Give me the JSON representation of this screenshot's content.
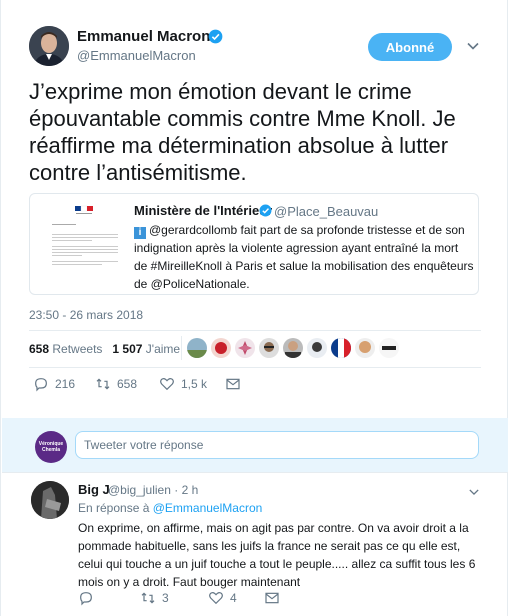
{
  "tweet": {
    "author_name": "Emmanuel Macron",
    "author_handle": "@EmmanuelMacron",
    "follow_button": "Abonné",
    "text": "J’exprime mon émotion devant le crime épouvantable commis contre Mme Knoll. Je réaffirme ma détermination absolue à lutter contre l’antisémitisme.",
    "timestamp": "23:50 - 26 mars 2018",
    "retweets_count": "658",
    "retweets_label": "Retweets",
    "likes_count": "1 507",
    "likes_label": "J'aime",
    "actions": {
      "reply": "216",
      "retweet": "658",
      "like": "1,5 k"
    }
  },
  "quoted": {
    "author_name": "Ministère de l'Intérieur",
    "author_handle": "@Place_Beauvau",
    "info_badge": "i",
    "text": "@gerardcollomb fait part de sa profonde tristesse et de son indignation après la violente agression ayant entraîné la mort de #MireilleKnoll à Paris et salue la mobilisation des enquêteurs de @PoliceNationale."
  },
  "compose": {
    "avatar_text": "Véronique Chemla",
    "placeholder": "Tweeter votre réponse"
  },
  "reply": {
    "author_name": "Big J",
    "author_handle": "@big_julien",
    "time": "· 2 h",
    "context_prefix": "En réponse à",
    "context_mention": "@EmmanuelMacron",
    "text": "On exprime, on affirme, mais on agit pas par contre.  On va avoir droit a la pommade habituelle, sans les juifs la france ne serait pas ce qu elle est, celui qui touche a un juif touche a tout le peuple..... allez ca suffit tous les 6 mois on y a droit. Faut bouger maintenant",
    "actions": {
      "retweet": "3",
      "like": "4"
    }
  },
  "colors": {
    "accent": "#1da1f2",
    "follow_bg": "#4ab3f4",
    "muted": "#657786",
    "compose_bg": "#e8f5fd"
  },
  "icons": [
    "verified-icon",
    "chevron-down-icon",
    "reply-icon",
    "retweet-icon",
    "like-icon",
    "message-icon",
    "info-icon"
  ]
}
